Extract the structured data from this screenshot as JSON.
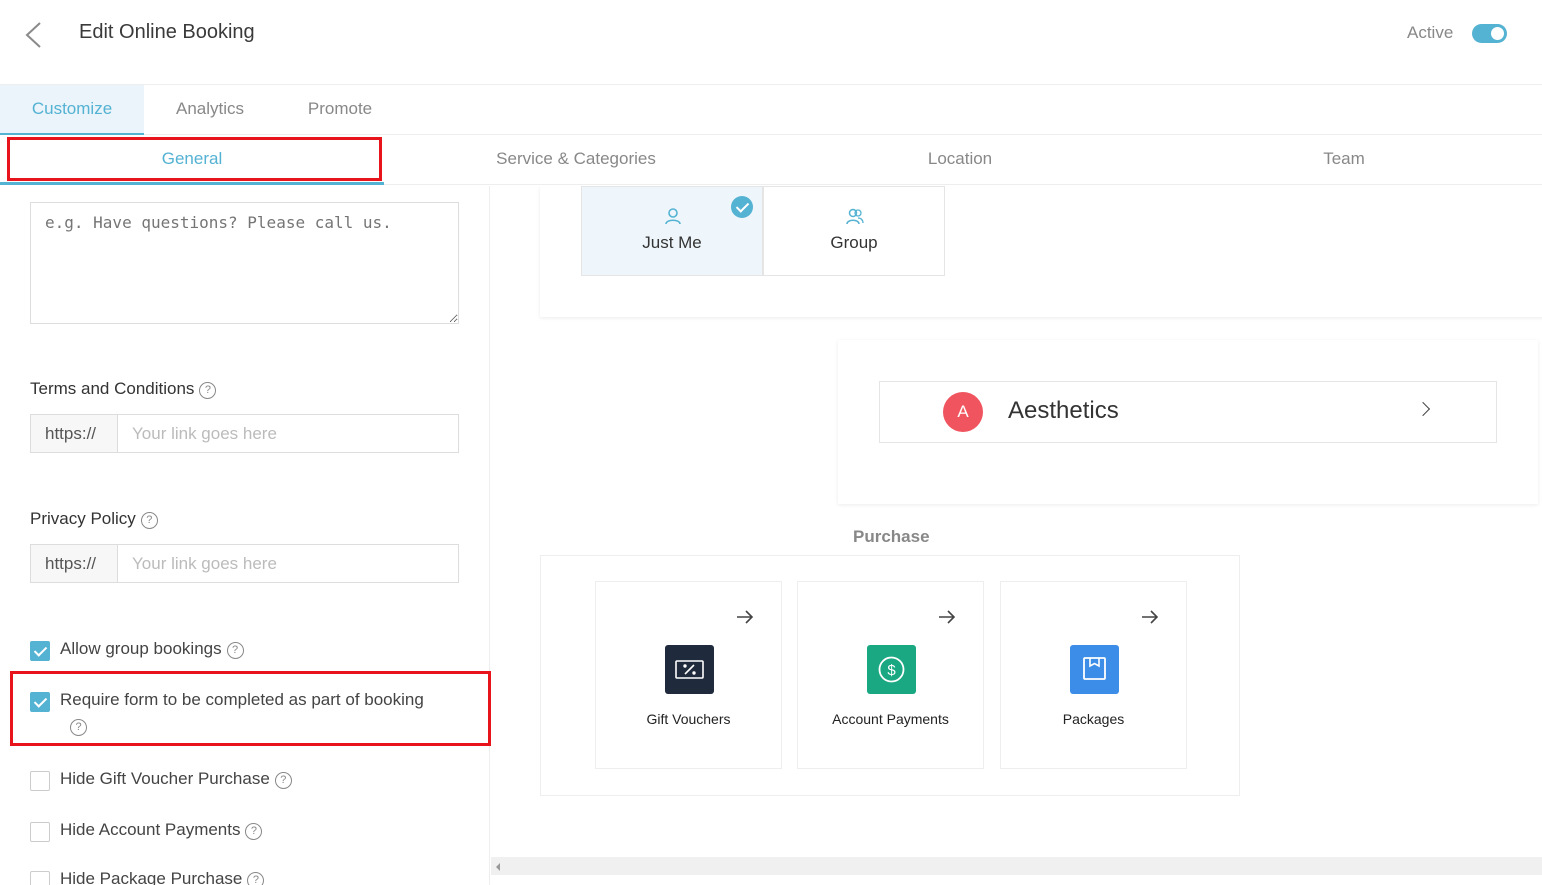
{
  "header": {
    "title": "Edit Online Booking",
    "active_label": "Active",
    "active_on": true
  },
  "tabs": [
    {
      "label": "Customize",
      "active": true
    },
    {
      "label": "Analytics",
      "active": false
    },
    {
      "label": "Promote",
      "active": false
    }
  ],
  "subtabs": [
    {
      "label": "General",
      "active": true
    },
    {
      "label": "Service & Categories",
      "active": false
    },
    {
      "label": "Location",
      "active": false
    },
    {
      "label": "Team",
      "active": false
    }
  ],
  "left": {
    "message_placeholder": "e.g. Have questions? Please call us.",
    "terms": {
      "label": "Terms and Conditions",
      "prefix": "https://",
      "placeholder": "Your link goes here"
    },
    "privacy": {
      "label": "Privacy Policy",
      "prefix": "https://",
      "placeholder": "Your link goes here"
    },
    "checkboxes": [
      {
        "label": "Allow group bookings",
        "checked": true
      },
      {
        "label": "Require form to be completed as part of booking",
        "checked": true
      },
      {
        "label": "Hide Gift Voucher Purchase",
        "checked": false
      },
      {
        "label": "Hide Account Payments",
        "checked": false
      },
      {
        "label": "Hide Package Purchase",
        "checked": false
      }
    ],
    "help_glyph": "?"
  },
  "preview": {
    "who": [
      {
        "label": "Just Me",
        "selected": true
      },
      {
        "label": "Group",
        "selected": false
      }
    ],
    "category": {
      "avatar_letter": "A",
      "name": "Aesthetics",
      "avatar_color": "#f0545e"
    },
    "purchase_title": "Purchase",
    "purchase_items": [
      {
        "label": "Gift Vouchers",
        "icon": "gift-voucher-icon",
        "color": "#1f2a3c"
      },
      {
        "label": "Account Payments",
        "icon": "dollar-icon",
        "color": "#1aa882"
      },
      {
        "label": "Packages",
        "icon": "package-icon",
        "color": "#3b8de8"
      }
    ]
  },
  "colors": {
    "accent": "#54b2d3",
    "highlight_border": "#e8141c"
  }
}
